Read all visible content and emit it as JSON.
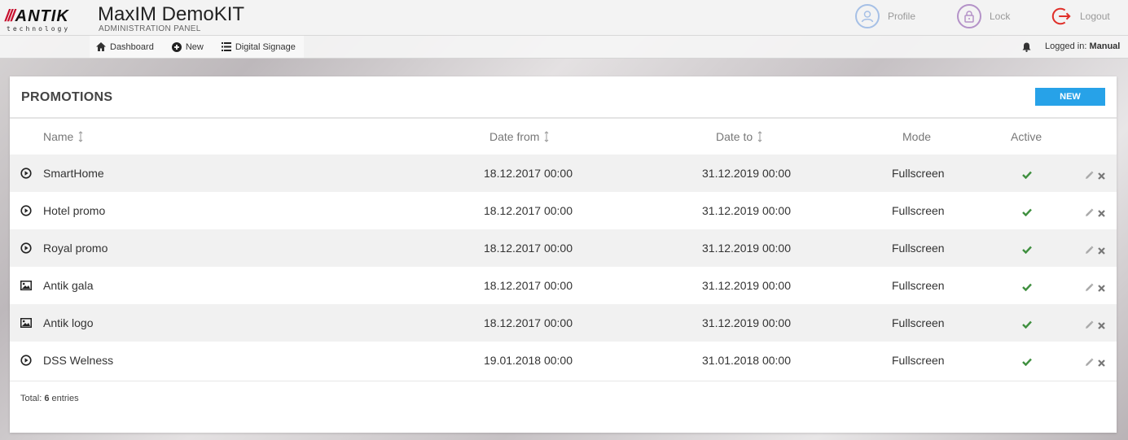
{
  "brand": {
    "logo_mark": "ANTIK",
    "logo_sub": "technology",
    "title": "MaxIM DemoKIT",
    "subtitle": "ADMINISTRATION PANEL"
  },
  "top_actions": {
    "profile": "Profile",
    "lock": "Lock",
    "logout": "Logout"
  },
  "nav": {
    "dashboard": "Dashboard",
    "new": "New",
    "digital_signage": "Digital Signage"
  },
  "login": {
    "prefix": "Logged in:",
    "user": "Manual"
  },
  "panel": {
    "title": "PROMOTIONS",
    "new_button": "NEW"
  },
  "table": {
    "columns": [
      "Name",
      "Date from",
      "Date to",
      "Mode",
      "Active"
    ],
    "rows": [
      {
        "type": "video",
        "name": "SmartHome",
        "date_from": "18.12.2017 00:00",
        "date_to": "31.12.2019 00:00",
        "mode": "Fullscreen",
        "active": true
      },
      {
        "type": "video",
        "name": "Hotel promo",
        "date_from": "18.12.2017 00:00",
        "date_to": "31.12.2019 00:00",
        "mode": "Fullscreen",
        "active": true
      },
      {
        "type": "video",
        "name": "Royal promo",
        "date_from": "18.12.2017 00:00",
        "date_to": "31.12.2019 00:00",
        "mode": "Fullscreen",
        "active": true
      },
      {
        "type": "image",
        "name": "Antik gala",
        "date_from": "18.12.2017 00:00",
        "date_to": "31.12.2019 00:00",
        "mode": "Fullscreen",
        "active": true
      },
      {
        "type": "image",
        "name": "Antik logo",
        "date_from": "18.12.2017 00:00",
        "date_to": "31.12.2019 00:00",
        "mode": "Fullscreen",
        "active": true
      },
      {
        "type": "video",
        "name": "DSS Welness",
        "date_from": "19.01.2018 00:00",
        "date_to": "31.01.2018 00:00",
        "mode": "Fullscreen",
        "active": true
      }
    ]
  },
  "footer": {
    "total_prefix": "Total:",
    "total_count": "6",
    "total_suffix": "entries"
  },
  "icons": {
    "profile": "user-circle-icon",
    "lock": "lock-circle-icon",
    "logout": "logout-icon",
    "dashboard": "home-icon",
    "new": "plus-circle-icon",
    "digital_signage": "list-icon",
    "bell": "bell-icon",
    "video": "play-circle-icon",
    "image": "image-icon",
    "active": "check-icon",
    "edit": "pencil-icon",
    "delete": "close-icon"
  },
  "colors": {
    "accent_blue": "#27a2e8",
    "brand_red": "#c8102e",
    "active_green": "#3f8f3f",
    "logout_red": "#e0302a"
  }
}
